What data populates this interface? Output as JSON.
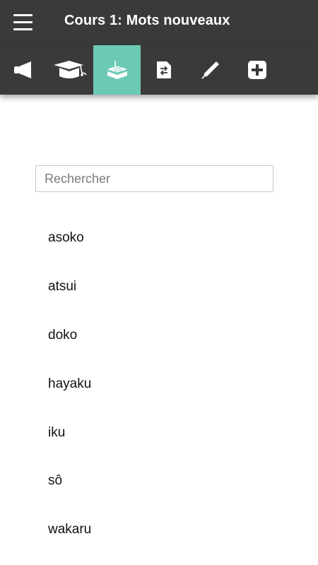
{
  "header": {
    "title": "Cours 1: Mots nouveaux",
    "menu_icon": "hamburger-menu-icon"
  },
  "toolbar": {
    "active_color": "#6cc9b4",
    "background_color": "#3a3a3a",
    "tabs": [
      {
        "icon": "megaphone-icon",
        "active": false
      },
      {
        "icon": "graduation-cap-icon",
        "active": false
      },
      {
        "icon": "vocabulary-box-icon",
        "active": true
      },
      {
        "icon": "document-swap-icon",
        "active": false
      },
      {
        "icon": "pen-icon",
        "active": false
      },
      {
        "icon": "plus-square-icon",
        "active": false
      }
    ]
  },
  "search": {
    "placeholder": "Rechercher",
    "value": ""
  },
  "words": [
    "asoko",
    "atsui",
    "doko",
    "hayaku",
    "iku",
    "sô",
    "wakaru"
  ]
}
